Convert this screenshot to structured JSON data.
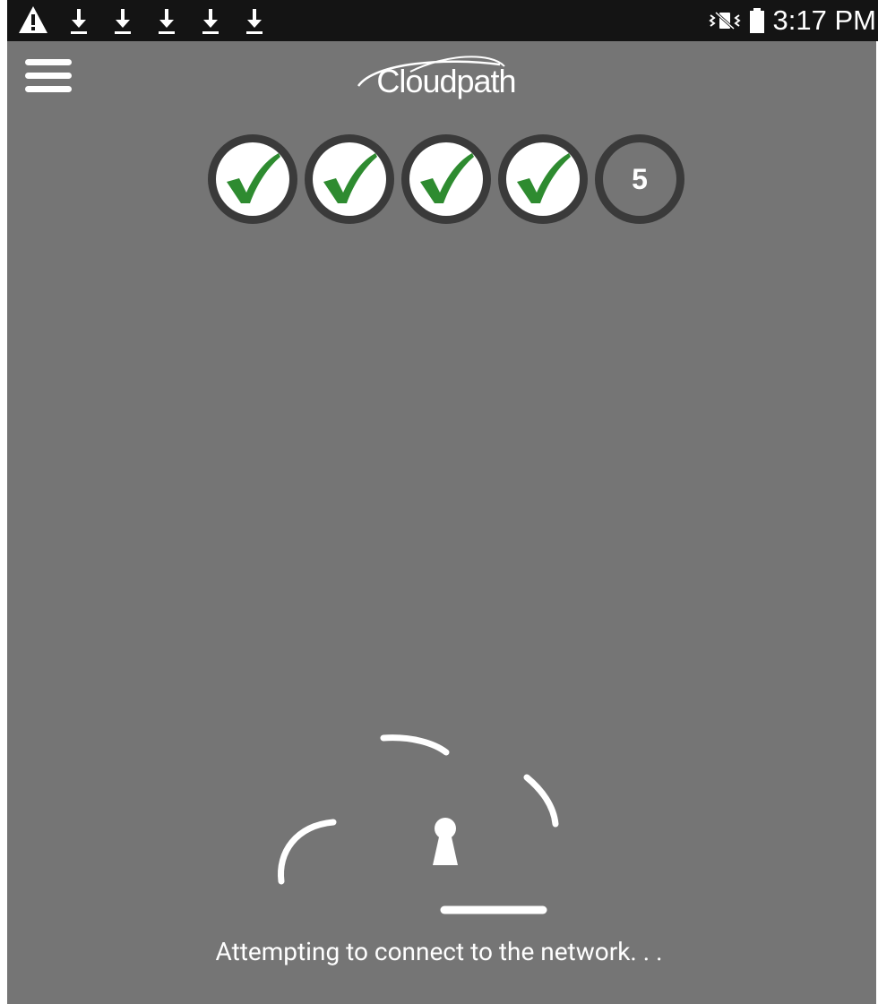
{
  "status_bar": {
    "icons": [
      "warning-icon",
      "download-icon",
      "download-icon",
      "download-icon",
      "download-icon",
      "download-icon",
      "vibrate-icon",
      "battery-icon"
    ],
    "time": "3:17 PM"
  },
  "header": {
    "menu_icon": "hamburger-menu-icon",
    "logo_text": "Cloudpath"
  },
  "progress_steps": [
    {
      "state": "complete",
      "icon": "checkmark-icon"
    },
    {
      "state": "complete",
      "icon": "checkmark-icon"
    },
    {
      "state": "complete",
      "icon": "checkmark-icon"
    },
    {
      "state": "complete",
      "icon": "checkmark-icon"
    },
    {
      "state": "current",
      "label": "5"
    }
  ],
  "connecting": {
    "icon": "cloud-lock-icon",
    "message": "Attempting to connect to the network. . ."
  },
  "colors": {
    "background": "#757575",
    "status_bar": "#141414",
    "check": "#2e8b30",
    "step_ring": "#3a3a3a"
  }
}
